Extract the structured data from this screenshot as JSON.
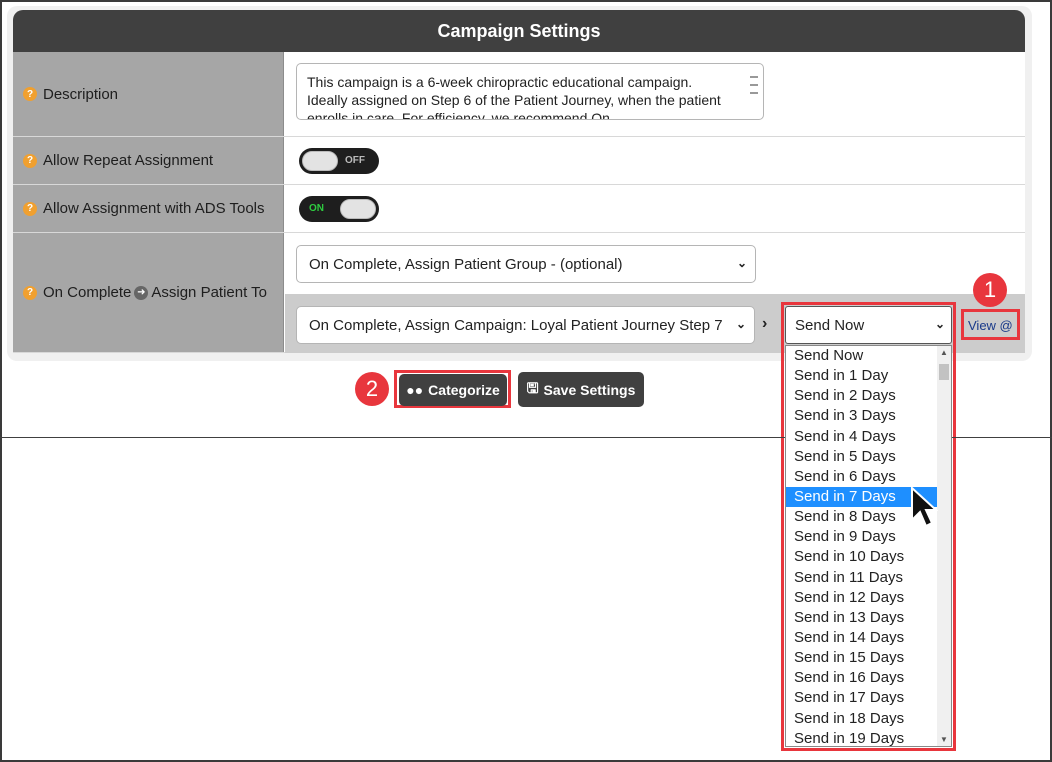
{
  "panel": {
    "title": "Campaign Settings"
  },
  "rows": {
    "description": {
      "label": "Description",
      "value": "This campaign is a 6-week chiropractic educational campaign. Ideally assigned on Step 6 of the Patient Journey, when the patient enrolls in care. For efficiency, we recommend On"
    },
    "repeat": {
      "label": "Allow Repeat Assignment",
      "state": "OFF"
    },
    "ads": {
      "label": "Allow Assignment with ADS Tools",
      "state": "ON"
    },
    "on_complete": {
      "label_part1": "On Complete",
      "label_part2": "Assign Patient To",
      "group_select": "On Complete, Assign Patient Group - (optional)",
      "campaign_select": "On Complete, Assign Campaign: Loyal Patient Journey Step 7",
      "send_select": "Send Now",
      "view_link": "View @"
    }
  },
  "buttons": {
    "categorize": "Categorize",
    "save": "Save Settings"
  },
  "badges": {
    "one": "1",
    "two": "2"
  },
  "dropdown": {
    "options": [
      "Send Now",
      "Send in 1 Day",
      "Send in 2 Days",
      "Send in 3 Days",
      "Send in 4 Days",
      "Send in 5 Days",
      "Send in 6 Days",
      "Send in 7 Days",
      "Send in 8 Days",
      "Send in 9 Days",
      "Send in 10 Days",
      "Send in 11 Days",
      "Send in 12 Days",
      "Send in 13 Days",
      "Send in 14 Days",
      "Send in 15 Days",
      "Send in 16 Days",
      "Send in 17 Days",
      "Send in 18 Days",
      "Send in 19 Days"
    ],
    "selected_index": 7
  },
  "colors": {
    "highlight": "#e8363d",
    "header": "#404040",
    "selected": "#1e8fff",
    "on_text": "#2ecc40"
  }
}
